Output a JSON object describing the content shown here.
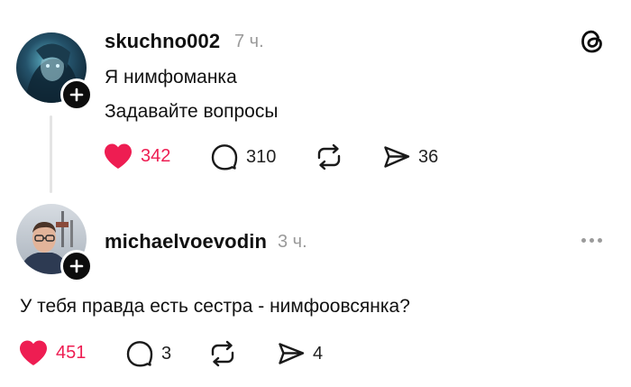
{
  "post1": {
    "username": "skuchno002",
    "time": "7 ч.",
    "lines": [
      "Я нимфоманка",
      "Задавайте вопросы"
    ],
    "likes": "342",
    "replies": "310",
    "shares": "36",
    "liked": true
  },
  "post2": {
    "username": "michaelvoevodin",
    "time": "3 ч.",
    "text": "У тебя правда есть сестра -  нимфоовсянка?",
    "likes": "451",
    "replies": "3",
    "shares": "4",
    "liked": true
  },
  "app": {
    "logo_icon": "threads-logo-icon"
  },
  "colors": {
    "like": "#ee1d52",
    "muted": "#9a9a9a",
    "text": "#111111"
  }
}
